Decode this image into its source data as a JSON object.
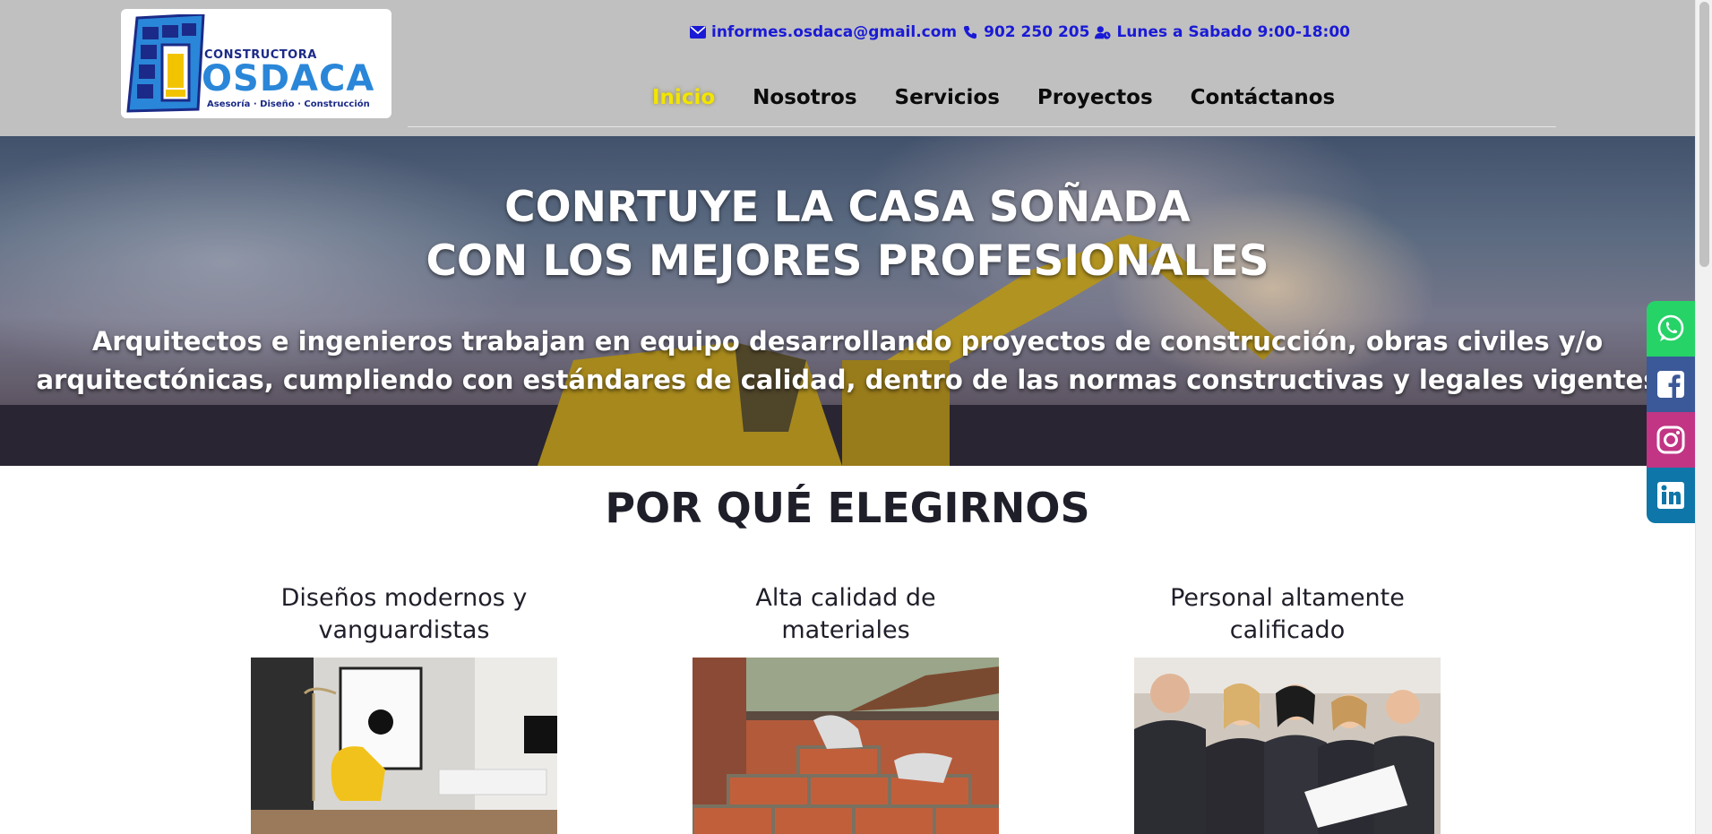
{
  "brand": {
    "pre": "CONSTRUCTORA",
    "name": "OSDACA",
    "tagline": "Asesoría · Diseño · Construcción"
  },
  "contact": {
    "email": "informes.osdaca@gmail.com",
    "phone": "902 250 205",
    "hours": "Lunes a Sabado 9:00-18:00",
    "icons": [
      "envelope-icon",
      "phone-icon",
      "user-clock-icon"
    ],
    "color": "#1a1ad6"
  },
  "nav": {
    "items": [
      {
        "label": "Inicio",
        "active": true
      },
      {
        "label": "Nosotros",
        "active": false
      },
      {
        "label": "Servicios",
        "active": false
      },
      {
        "label": "Proyectos",
        "active": false
      },
      {
        "label": "Contáctanos",
        "active": false
      }
    ],
    "active_color": "#f2e500"
  },
  "hero": {
    "title_line1": "CONRTUYE LA CASA SOÑADA",
    "title_line2": "CON LOS MEJORES PROFESIONALES",
    "text_line1": "Arquitectos e ingenieros trabajan en equipo desarrollando proyectos de construcción, obras civiles y/o",
    "text_line2": "arquitectónicas, cumpliendo con estándares de calidad, dentro de las normas constructivas y legales vigentes"
  },
  "social": [
    {
      "name": "whatsapp",
      "icon": "whatsapp-icon",
      "color": "#26d367"
    },
    {
      "name": "facebook",
      "icon": "facebook-icon",
      "color": "#3b5998"
    },
    {
      "name": "instagram",
      "icon": "instagram-icon",
      "color": "#c13584"
    },
    {
      "name": "linkedin",
      "icon": "linkedin-icon",
      "color": "#0e76a8"
    }
  ],
  "why": {
    "title": "POR QUÉ ELEGIRNOS",
    "features": [
      {
        "line1": "Diseños modernos y",
        "line2": "vanguardistas"
      },
      {
        "line1": "Alta calidad de",
        "line2": "materiales"
      },
      {
        "line1": "Personal altamente",
        "line2": "calificado"
      }
    ]
  }
}
